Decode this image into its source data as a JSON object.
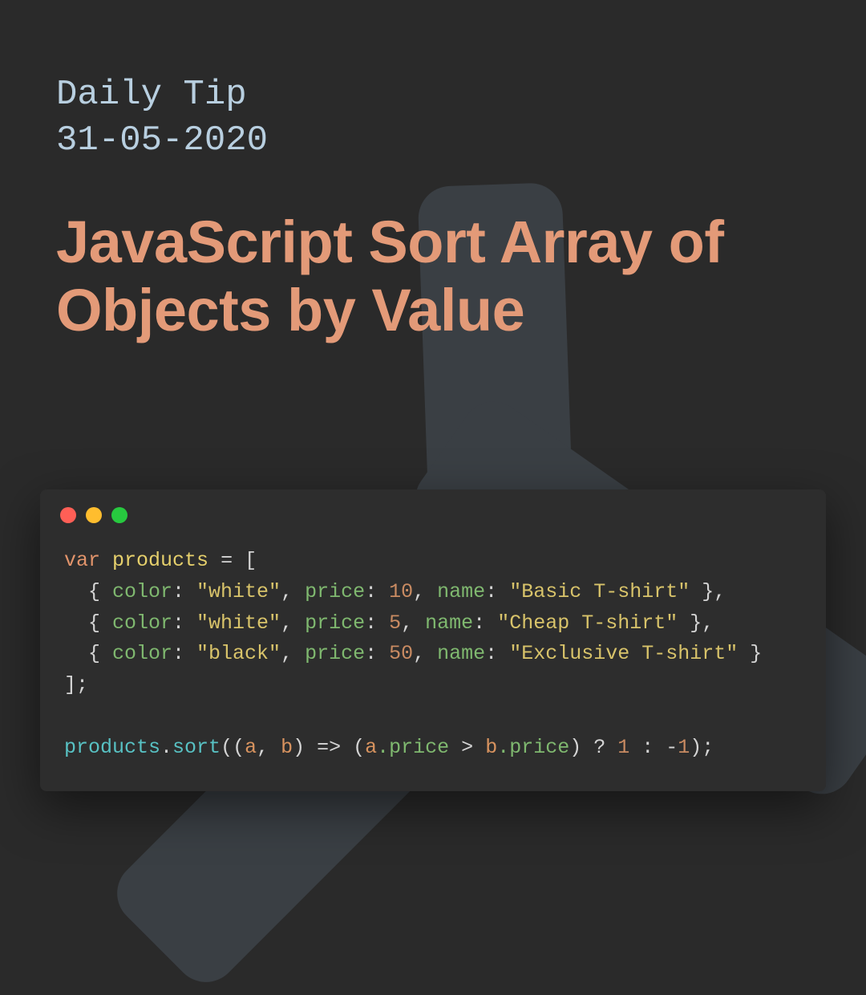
{
  "header": {
    "subtitle_line1": "Daily Tip",
    "subtitle_line2": "31-05-2020",
    "title": "JavaScript Sort Array of Objects by Value"
  },
  "window": {
    "controls": [
      "close",
      "minimize",
      "maximize"
    ]
  },
  "code": {
    "keyword_var": "var",
    "var_products": "products",
    "eq": " = [",
    "obj_open": "  { ",
    "prop_color": "color",
    "colon": ": ",
    "comma": ", ",
    "prop_price": "price",
    "prop_name": "name",
    "obj_close": " },",
    "obj_close_last": " }",
    "arr_close": "];",
    "row1_color": "\"white\"",
    "row1_price": "10",
    "row1_name": "\"Basic T-shirt\"",
    "row2_color": "\"white\"",
    "row2_price": "5",
    "row2_name": "\"Cheap T-shirt\"",
    "row3_color": "\"black\"",
    "row3_price": "50",
    "row3_name": "\"Exclusive T-shirt\"",
    "sort_obj": "products",
    "sort_dot": ".",
    "sort_fn": "sort",
    "sort_open": "((",
    "param_a": "a",
    "param_b": "b",
    "sort_mid1": ", ",
    "sort_arrow": ") => (",
    "sort_a": "a",
    "sort_price1": ".price",
    "sort_gt": " > ",
    "sort_b": "b",
    "sort_price2": ".price",
    "sort_tern": ") ? ",
    "sort_one": "1",
    "sort_colon": " : ",
    "sort_neg": "-",
    "sort_one2": "1",
    "sort_end": ");"
  }
}
